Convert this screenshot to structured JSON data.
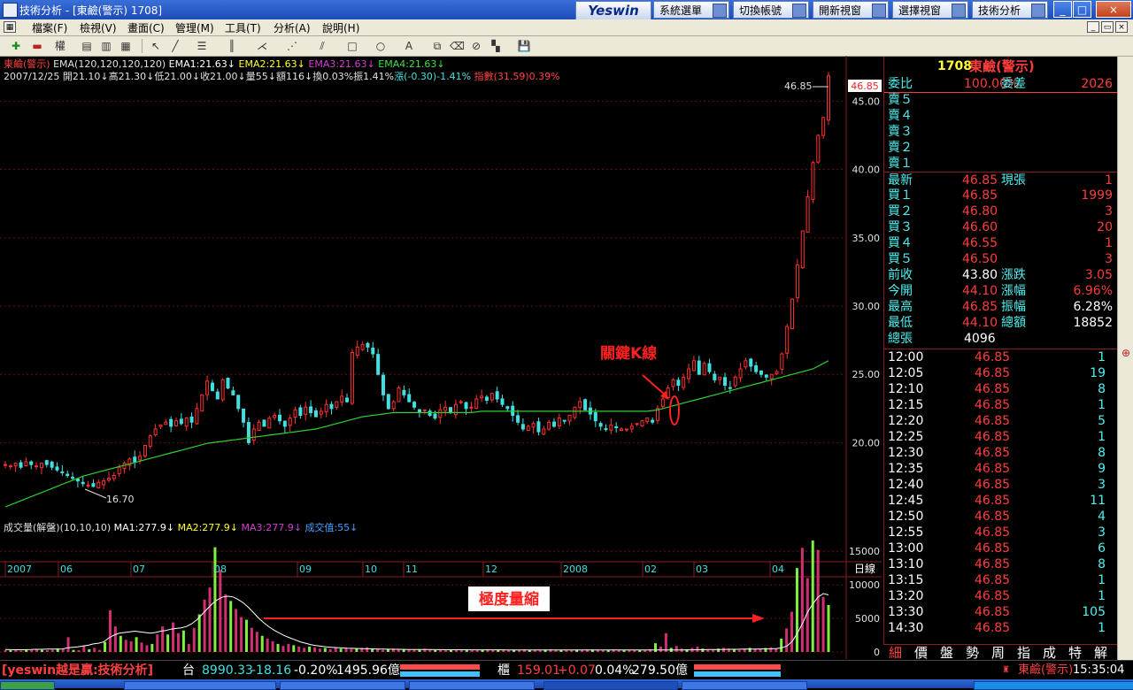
{
  "window": {
    "app_name": "技術分析",
    "title": "技術分析 - [東鹼(警示) 1708]",
    "brand": "Yeswin",
    "buttons": [
      "系統選單",
      "切換帳號",
      "開新視窗",
      "選擇視窗",
      "技術分析"
    ],
    "controls": [
      "_",
      "□",
      "×"
    ]
  },
  "menu": {
    "items": [
      "檔案(F)",
      "檢視(V)",
      "畫面(C)",
      "管理(M)",
      "工具(T)",
      "分析(A)",
      "說明(H)"
    ]
  },
  "toolbar": {
    "kline_label": "權"
  },
  "chart_header": {
    "line1": [
      {
        "text": "東鹼(警示)",
        "color": "#ff4040"
      },
      {
        "text": " EMA(120,120,120,120)",
        "color": "#e0e0e0"
      },
      {
        "text": " EMA1:21.63↓",
        "color": "#ffffff"
      },
      {
        "text": " EMA2:21.63↓",
        "color": "#ffff30"
      },
      {
        "text": " EMA3:21.63↓",
        "color": "#d040d0"
      },
      {
        "text": " EMA4:21.63↓",
        "color": "#40e040"
      }
    ],
    "line2": [
      {
        "text": "2007/12/25",
        "color": "#e0e0e0"
      },
      {
        "text": " 開21.10↓",
        "color": "#e0e0e0"
      },
      {
        "text": "高21.30↓",
        "color": "#e0e0e0"
      },
      {
        "text": "低21.00↓",
        "color": "#e0e0e0"
      },
      {
        "text": "收21.00↓",
        "color": "#e0e0e0"
      },
      {
        "text": "量55↓",
        "color": "#e0e0e0"
      },
      {
        "text": "額116↓",
        "color": "#e0e0e0"
      },
      {
        "text": "換0.03%",
        "color": "#e0e0e0"
      },
      {
        "text": "振1.41%",
        "color": "#e0e0e0"
      },
      {
        "text": "漲(-0.30)-1.41%",
        "color": "#40e0e0"
      },
      {
        "text": " 指數(31.59)0.39%",
        "color": "#ff4040"
      }
    ],
    "volume_line": [
      {
        "text": "成交量(解盤)(10,10,10)",
        "color": "#e0e0e0"
      },
      {
        "text": " MA1:277.9↓",
        "color": "#ffffff"
      },
      {
        "text": " MA2:277.9↓",
        "color": "#ffff30"
      },
      {
        "text": " MA3:277.9↓",
        "color": "#d040d0"
      },
      {
        "text": " 成交值:55↓",
        "color": "#40a0ff"
      }
    ]
  },
  "chart_data": {
    "type": "candlestick",
    "price_axis": {
      "ticks": [
        "45.00",
        "40.00",
        "35.00",
        "30.00",
        "25.00",
        "20.00"
      ],
      "ylim": [
        15.3,
        48.0
      ]
    },
    "volume_axis": {
      "ticks": [
        "15000",
        "10000",
        "5000",
        "0"
      ],
      "ylim": [
        0,
        17000
      ]
    },
    "x_axis": {
      "labels": [
        "2007",
        "06",
        "07",
        "08",
        "09",
        "10",
        "11",
        "12",
        "2008",
        "02",
        "03",
        "04"
      ],
      "period_label": "日線"
    },
    "high_marker": "46.85",
    "low_marker": "16.70",
    "current_price_tag": "46.85",
    "annotations": {
      "key_candle": "關鍵K線",
      "volume_shrink": "極度量縮"
    },
    "close_series": [
      18.4,
      18.3,
      18.5,
      18.2,
      18.6,
      18.4,
      18.3,
      18.5,
      18.4,
      18.2,
      18.0,
      17.8,
      17.6,
      17.4,
      17.2,
      17.0,
      16.9,
      16.8,
      17.1,
      17.2,
      17.4,
      17.6,
      18.2,
      18.5,
      18.8,
      18.6,
      19.0,
      19.8,
      20.5,
      21.0,
      21.3,
      21.5,
      21.2,
      21.6,
      21.4,
      21.8,
      21.5,
      22.5,
      23.5,
      24.5,
      23.8,
      23.2,
      24.6,
      24.0,
      23.5,
      22.5,
      21.5,
      20.0,
      21.0,
      21.5,
      21.2,
      21.8,
      22.0,
      21.6,
      21.2,
      21.8,
      22.4,
      22.0,
      22.6,
      22.2,
      21.9,
      22.3,
      22.8,
      22.5,
      23.0,
      23.4,
      23.0,
      26.6,
      27.0,
      27.2,
      27.0,
      26.5,
      25.0,
      23.5,
      22.5,
      23.0,
      24.0,
      23.5,
      23.0,
      22.6,
      22.2,
      22.4,
      22.0,
      21.8,
      22.4,
      22.6,
      22.2,
      22.8,
      23.0,
      22.5,
      22.6,
      23.2,
      23.4,
      23.1,
      23.6,
      23.2,
      22.8,
      22.5,
      22.0,
      21.5,
      21.0,
      21.2,
      21.4,
      20.8,
      21.0,
      21.5,
      21.2,
      21.8,
      21.6,
      22.0,
      22.6,
      23.0,
      22.4,
      22.1,
      21.6,
      21.2,
      21.0,
      21.3,
      21.1,
      21.0,
      21.0,
      21.2,
      21.4,
      21.6,
      21.8,
      21.5,
      22.5,
      23.2,
      24.0,
      24.6,
      24.2,
      24.8,
      25.4,
      26.0,
      25.0,
      25.8,
      25.2,
      24.6,
      24.8,
      24.2,
      24.0,
      24.8,
      25.4,
      26.0,
      25.6,
      25.2,
      25.0,
      24.8,
      25.0,
      25.2,
      26.5,
      28.5,
      30.5,
      33.0,
      35.5,
      38.0,
      40.5,
      42.5,
      43.8,
      46.85
    ],
    "ema_series": [
      15.3,
      15.45,
      15.6,
      15.75,
      15.9,
      16.05,
      16.2,
      16.35,
      16.5,
      16.65,
      16.8,
      16.95,
      17.1,
      17.25,
      17.4,
      17.55,
      17.65,
      17.75,
      17.85,
      17.95,
      18.05,
      18.15,
      18.25,
      18.35,
      18.45,
      18.55,
      18.65,
      18.75,
      18.85,
      18.95,
      19.05,
      19.15,
      19.25,
      19.35,
      19.45,
      19.55,
      19.65,
      19.75,
      19.85,
      19.95,
      20.0,
      20.05,
      20.1,
      20.15,
      20.2,
      20.25,
      20.3,
      20.35,
      20.4,
      20.45,
      20.5,
      20.55,
      20.6,
      20.65,
      20.7,
      20.75,
      20.8,
      20.85,
      20.9,
      20.95,
      21.0,
      21.1,
      21.2,
      21.3,
      21.4,
      21.5,
      21.6,
      21.7,
      21.8,
      21.9,
      21.95,
      22.0,
      22.05,
      22.1,
      22.15,
      22.2,
      22.2,
      22.2,
      22.2,
      22.2,
      22.2,
      22.2,
      22.2,
      22.2,
      22.2,
      22.2,
      22.2,
      22.2,
      22.2,
      22.2,
      22.2,
      22.25,
      22.3,
      22.3,
      22.3,
      22.3,
      22.3,
      22.3,
      22.3,
      22.3,
      22.3,
      22.3,
      22.3,
      22.3,
      22.3,
      22.3,
      22.3,
      22.3,
      22.3,
      22.3,
      22.3,
      22.3,
      22.3,
      22.3,
      22.3,
      22.3,
      22.3,
      22.3,
      22.3,
      22.3,
      22.3,
      22.3,
      22.3,
      22.3,
      22.3,
      22.35,
      22.4,
      22.5,
      22.6,
      22.7,
      22.8,
      22.9,
      23.0,
      23.1,
      23.2,
      23.3,
      23.4,
      23.5,
      23.6,
      23.7,
      23.8,
      23.9,
      24.0,
      24.1,
      24.2,
      24.3,
      24.4,
      24.5,
      24.6,
      24.7,
      24.8,
      24.9,
      25.0,
      25.1,
      25.2,
      25.3,
      25.4,
      25.6,
      25.8,
      26.0
    ],
    "volume_series": [
      300,
      250,
      400,
      200,
      350,
      280,
      420,
      300,
      260,
      320,
      500,
      380,
      2200,
      300,
      260,
      900,
      400,
      600,
      300,
      1500,
      6200,
      3800,
      2400,
      1800,
      1600,
      2200,
      1400,
      1000,
      1200,
      2600,
      3800,
      2600,
      4400,
      2800,
      3200,
      1200,
      3600,
      5600,
      7800,
      9600,
      15600,
      12200,
      8600,
      7600,
      6400,
      5200,
      4800,
      3600,
      3000,
      2400,
      2000,
      1600,
      1200,
      900,
      1200,
      1000,
      800,
      600,
      800,
      700,
      500,
      600,
      400,
      700,
      500,
      600,
      450,
      500,
      600,
      700,
      400,
      500,
      300,
      400,
      500,
      400,
      350,
      300,
      400,
      350,
      500,
      400,
      300,
      350,
      250,
      300,
      400,
      350,
      300,
      250,
      350,
      300,
      400,
      300,
      350,
      300,
      250,
      350,
      300,
      400,
      300,
      300,
      250,
      350,
      400,
      350,
      300,
      250,
      300,
      350,
      300,
      400,
      350,
      300,
      250,
      300,
      400,
      300,
      250,
      350,
      300,
      250,
      300,
      400,
      1300,
      800,
      2800,
      600,
      900,
      500,
      400,
      600,
      800,
      500,
      400,
      350,
      500,
      600,
      500,
      400,
      300,
      500,
      600,
      500,
      400,
      600,
      700,
      500,
      2000,
      3500,
      6000,
      12500,
      15500,
      11000,
      16600,
      15200,
      8200,
      7000
    ],
    "volume_ma_series": [
      350,
      340,
      330,
      330,
      340,
      360,
      400,
      400,
      420,
      420,
      430,
      450,
      600,
      700,
      750,
      900,
      1000,
      1200,
      1300,
      1500,
      2100,
      2500,
      2800,
      2900,
      3000,
      3100,
      3000,
      2900,
      2800,
      2900,
      3100,
      3200,
      3400,
      3500,
      3600,
      3800,
      4200,
      4800,
      5600,
      6400,
      7200,
      7800,
      8200,
      8300,
      8200,
      7800,
      7300,
      6600,
      5800,
      5000,
      4300,
      3700,
      3200,
      2800,
      2400,
      2100,
      1800,
      1500,
      1300,
      1100,
      950,
      850,
      750,
      700,
      650,
      600,
      560,
      540,
      520,
      500,
      480,
      460,
      440,
      420,
      410,
      400,
      390,
      380,
      370,
      360,
      360,
      355,
      350,
      345,
      340,
      335,
      330,
      328,
      326,
      324,
      322,
      320,
      318,
      316,
      314,
      312,
      310,
      308,
      306,
      304,
      302,
      300,
      298,
      296,
      294,
      292,
      290,
      290,
      290,
      290,
      290,
      290,
      290,
      290,
      290,
      290,
      290,
      290,
      290,
      290,
      290,
      290,
      290,
      290,
      290,
      290,
      290,
      290,
      290,
      290,
      290,
      300,
      310,
      320,
      330,
      340,
      350,
      360,
      370,
      380,
      390,
      400,
      410,
      420,
      430,
      440,
      450,
      460,
      480,
      520,
      620,
      900,
      1600,
      2800,
      4300,
      6000,
      7200,
      8200,
      8700,
      8500
    ]
  },
  "quote": {
    "code": "1708",
    "name": "東鹼(警示)",
    "ratio_label": "委比",
    "ratio_value": "100.00%",
    "diff_label": "委差",
    "diff_value": "2026",
    "asks": [
      {
        "label": "賣５"
      },
      {
        "label": "賣４"
      },
      {
        "label": "賣３"
      },
      {
        "label": "賣２"
      },
      {
        "label": "賣１"
      }
    ],
    "latest": {
      "label": "最新",
      "price": "46.85",
      "tag": "現張",
      "qty": "1"
    },
    "bids": [
      {
        "label": "買１",
        "price": "46.85",
        "qty": "1999"
      },
      {
        "label": "買２",
        "price": "46.80",
        "qty": "3"
      },
      {
        "label": "買３",
        "price": "46.60",
        "qty": "20"
      },
      {
        "label": "買４",
        "price": "46.55",
        "qty": "1"
      },
      {
        "label": "買５",
        "price": "46.50",
        "qty": "3"
      }
    ],
    "stats": [
      {
        "l1": "前收",
        "v1": "43.80",
        "l2": "漲跌",
        "v2": "3.05"
      },
      {
        "l1": "今開",
        "v1": "44.10",
        "l2": "漲幅",
        "v2": "6.96%"
      },
      {
        "l1": "最高",
        "v1": "46.85",
        "l2": "振幅",
        "v2": "6.28%"
      },
      {
        "l1": "最低",
        "v1": "44.10",
        "l2": "總額",
        "v2": "18852"
      }
    ],
    "total_label": "總張",
    "total_value": "4096",
    "ticks": [
      {
        "time": "12:00",
        "price": "46.85",
        "qty": "1"
      },
      {
        "time": "12:05",
        "price": "46.85",
        "qty": "19"
      },
      {
        "time": "12:10",
        "price": "46.85",
        "qty": "8"
      },
      {
        "time": "12:15",
        "price": "46.85",
        "qty": "1"
      },
      {
        "time": "12:20",
        "price": "46.85",
        "qty": "5"
      },
      {
        "time": "12:25",
        "price": "46.85",
        "qty": "1"
      },
      {
        "time": "12:30",
        "price": "46.85",
        "qty": "8"
      },
      {
        "time": "12:35",
        "price": "46.85",
        "qty": "9"
      },
      {
        "time": "12:40",
        "price": "46.85",
        "qty": "3"
      },
      {
        "time": "12:45",
        "price": "46.85",
        "qty": "11"
      },
      {
        "time": "12:50",
        "price": "46.85",
        "qty": "4"
      },
      {
        "time": "12:55",
        "price": "46.85",
        "qty": "3"
      },
      {
        "time": "13:00",
        "price": "46.85",
        "qty": "6"
      },
      {
        "time": "13:10",
        "price": "46.85",
        "qty": "8"
      },
      {
        "time": "13:15",
        "price": "46.85",
        "qty": "1"
      },
      {
        "time": "13:20",
        "price": "46.85",
        "qty": "1"
      },
      {
        "time": "13:30",
        "price": "46.85",
        "qty": "105"
      },
      {
        "time": "14:30",
        "price": "46.85",
        "qty": "1"
      }
    ],
    "tabs": [
      "細",
      "價",
      "盤",
      "勢",
      "周",
      "指",
      "成",
      "特",
      "解"
    ]
  },
  "status": {
    "brand": "[yeswin越是贏:技術分析]",
    "twse_label": "台",
    "twse_index": "8990.33",
    "twse_change": "-18.16",
    "twse_pct": "-0.20%",
    "twse_amount": "1495.96億",
    "otc_label": "櫃",
    "otc_index": "159.01",
    "otc_change": "+0.07",
    "otc_pct": "0.04%",
    "otc_amount": "279.50億",
    "watch_name": "東鹼(警示)",
    "clock": "15:35:04"
  }
}
